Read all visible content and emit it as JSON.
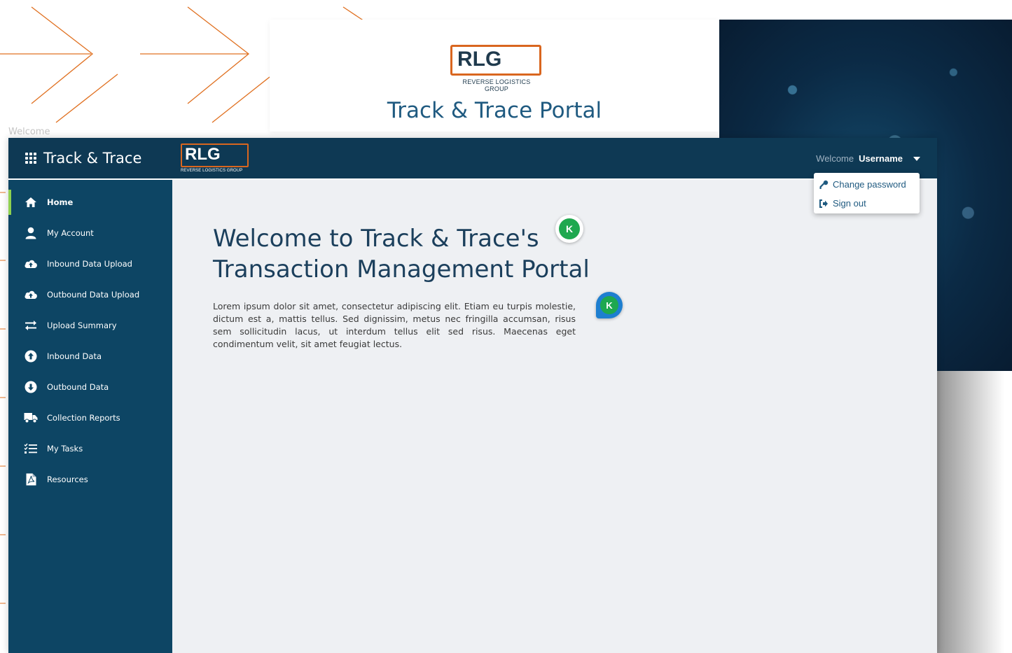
{
  "background": {
    "logo_word": "RLG",
    "logo_sub": "REVERSE LOGISTICS GROUP",
    "portal_title": "Track & Trace Portal",
    "window_tab": "Welcome"
  },
  "header": {
    "app_title": "Track & Trace",
    "logo_word": "RLG",
    "logo_sub": "REVERSE LOGISTICS GROUP",
    "welcome_label": "Welcome",
    "username": "Username"
  },
  "user_menu": {
    "items": [
      {
        "label": "Change password",
        "icon": "key-icon"
      },
      {
        "label": "Sign out",
        "icon": "sign-out-icon"
      }
    ]
  },
  "sidebar": {
    "items": [
      {
        "label": "Home",
        "icon": "home-icon",
        "active": true
      },
      {
        "label": "My Account",
        "icon": "user-icon"
      },
      {
        "label": "Inbound Data Upload",
        "icon": "cloud-upload-icon"
      },
      {
        "label": "Outbound Data Upload",
        "icon": "cloud-upload-icon"
      },
      {
        "label": "Upload Summary",
        "icon": "exchange-icon"
      },
      {
        "label": "Inbound Data",
        "icon": "arrow-circle-up-icon"
      },
      {
        "label": "Outbound Data",
        "icon": "arrow-circle-down-icon"
      },
      {
        "label": "Collection Reports",
        "icon": "truck-icon"
      },
      {
        "label": "My Tasks",
        "icon": "tasks-icon"
      },
      {
        "label": "Resources",
        "icon": "pdf-file-icon"
      }
    ]
  },
  "main": {
    "headline": "Welcome to Track & Trace's Transaction Management Portal",
    "body": "Lorem ipsum dolor sit amet, consectetur adipiscing elit. Etiam eu turpis molestie, dictum est a, mattis tellus. Sed dignissim, metus nec fringilla accumsan, risus sem sollicitudin lacus, ut interdum tellus elit sed risus. Maecenas eget condimentum velit, sit amet feugiat lectus.",
    "badge_letter": "K"
  },
  "colors": {
    "topbar": "#0e3954",
    "sidebar": "#0d4564",
    "accent_orange": "#d9661f",
    "active_indicator": "#8fd14f",
    "content_bg": "#eef0f3"
  }
}
